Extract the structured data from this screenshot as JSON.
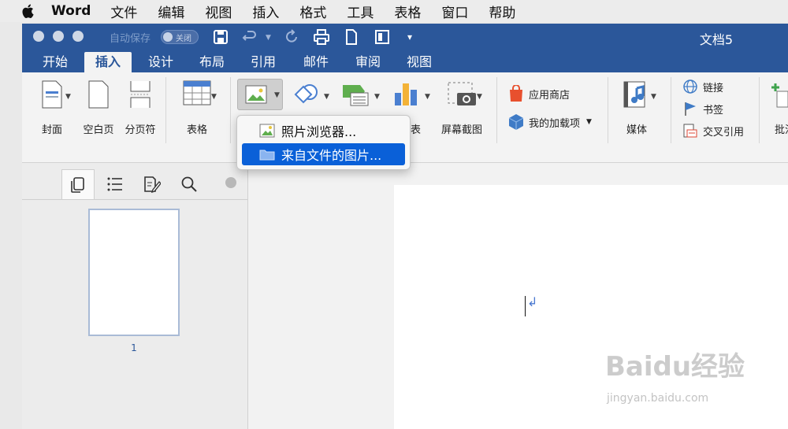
{
  "menubar": {
    "app": "Word",
    "items": [
      "文件",
      "编辑",
      "视图",
      "插入",
      "格式",
      "工具",
      "表格",
      "窗口",
      "帮助"
    ]
  },
  "window": {
    "autosave_label": "自动保存",
    "autosave_state": "关闭",
    "doc_title": "文档5"
  },
  "tabs": [
    "开始",
    "插入",
    "设计",
    "布局",
    "引用",
    "邮件",
    "审阅",
    "视图"
  ],
  "active_tab": "插入",
  "ribbon": {
    "cover": "封面",
    "blank_page": "空白页",
    "page_break": "分页符",
    "table": "表格",
    "chart_partial": "图表",
    "screenshot": "屏幕截图",
    "app_store": "应用商店",
    "my_addins": "我的加载项",
    "media": "媒体",
    "link": "链接",
    "bookmark": "书签",
    "cross_ref": "交叉引用",
    "comment_partial": "批注"
  },
  "picture_menu": {
    "items": [
      "照片浏览器...",
      "来自文件的图片..."
    ],
    "selected": "来自文件的图片..."
  },
  "nav": {
    "page_number": "1"
  },
  "doc": {
    "para_mark": "↲"
  },
  "watermark": {
    "brand": "Baidu经验",
    "url": "jingyan.baidu.com"
  },
  "colors": {
    "title_blue": "#2b579a",
    "menu_selected": "#0a60d8"
  }
}
